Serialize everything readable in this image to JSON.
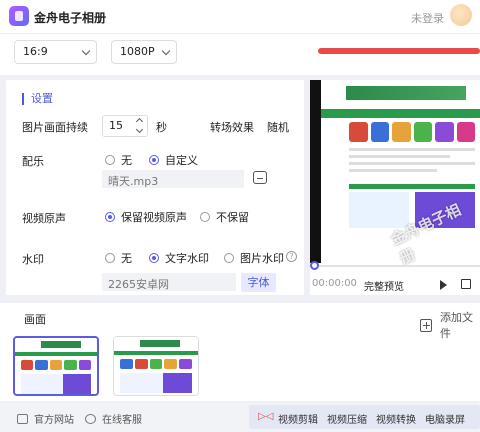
{
  "app": {
    "title": "金舟电子相册",
    "login": "未登录"
  },
  "toolbar": {
    "ratio": "16:9",
    "resolution": "1080P"
  },
  "settings": {
    "section_title": "设置",
    "duration_label": "图片画面持续",
    "duration_value": "15",
    "duration_unit": "秒",
    "transition_label": "转场效果",
    "transition_value": "随机",
    "music_label": "配乐",
    "music_none": "无",
    "music_custom": "自定义",
    "music_file": "晴天.mp3",
    "original_audio_label": "视频原声",
    "keep_audio": "保留视频原声",
    "drop_audio": "不保留",
    "watermark_label": "水印",
    "wm_none": "无",
    "wm_text": "文字水印",
    "wm_image": "图片水印",
    "wm_text_value": "2265安卓网",
    "font_button": "字体"
  },
  "preview": {
    "watermark_overlay": "金舟电子相册",
    "time": "00:00:00",
    "label": "完整预览"
  },
  "frames": {
    "title": "画面",
    "add_file": "添加文件"
  },
  "bottom": {
    "official_site": "官方网站",
    "online_service": "在线客服",
    "links": [
      "视频剪辑",
      "视频压缩",
      "视频转换",
      "电脑录屏"
    ]
  },
  "colors": {
    "accent": "#5a5ce6",
    "red": "#e84a4a",
    "green": "#2a9b4a"
  }
}
